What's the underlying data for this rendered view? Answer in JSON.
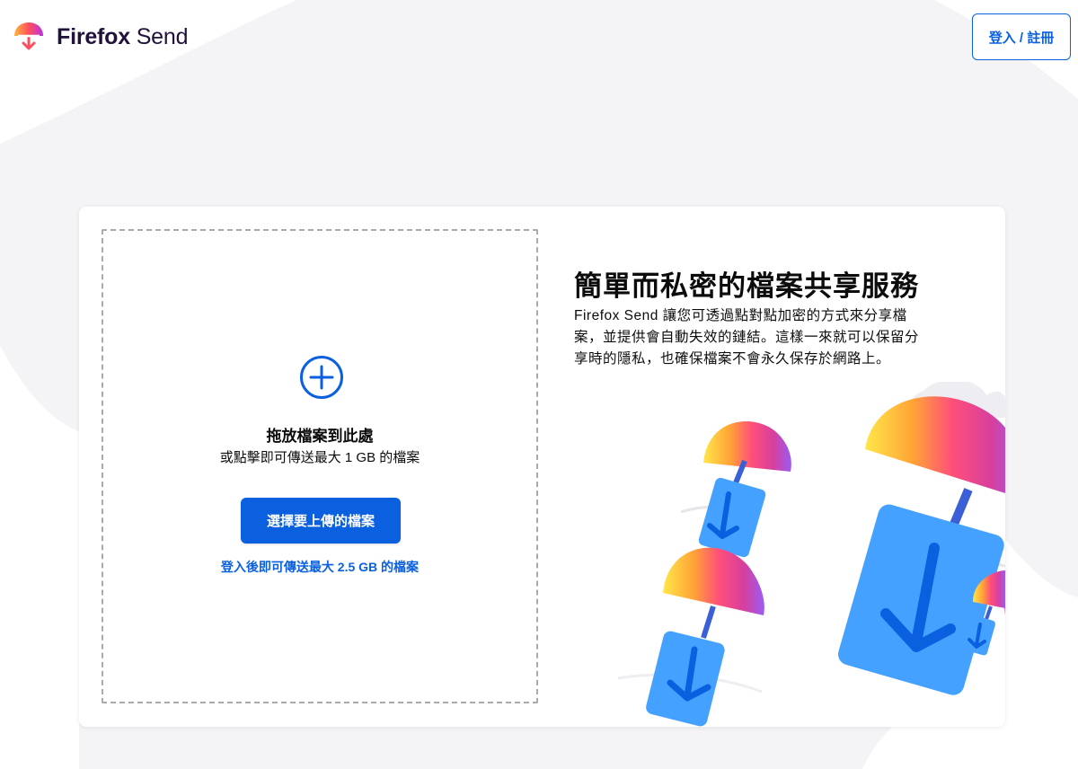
{
  "header": {
    "logo_bold": "Firefox",
    "logo_light": "Send",
    "signin_label": "登入 / 註冊"
  },
  "upload": {
    "drop_title": "拖放檔案到此處",
    "drop_subtitle": "或點擊即可傳送最大 1 GB 的檔案",
    "choose_button": "選擇要上傳的檔案",
    "signin_hint": "登入後即可傳送最大 2.5 GB 的檔案"
  },
  "intro": {
    "title": "簡單而私密的檔案共享服務",
    "description": "Firefox Send 讓您可透過點對點加密的方式來分享檔案，並提供會自動失效的鏈結。這樣一來就可以保留分享時的隱私，也確保檔案不會永久保存於網路上。"
  },
  "colors": {
    "accent": "#0a60df",
    "background": "#f4f4f6",
    "card": "#ffffff",
    "text": "#0c0c0d",
    "logo_text": "#20123a"
  },
  "icons": {
    "logo": "firefox-send-parachute-logo",
    "add": "plus-circle-icon",
    "illustration": "parachute-files-illustration"
  }
}
